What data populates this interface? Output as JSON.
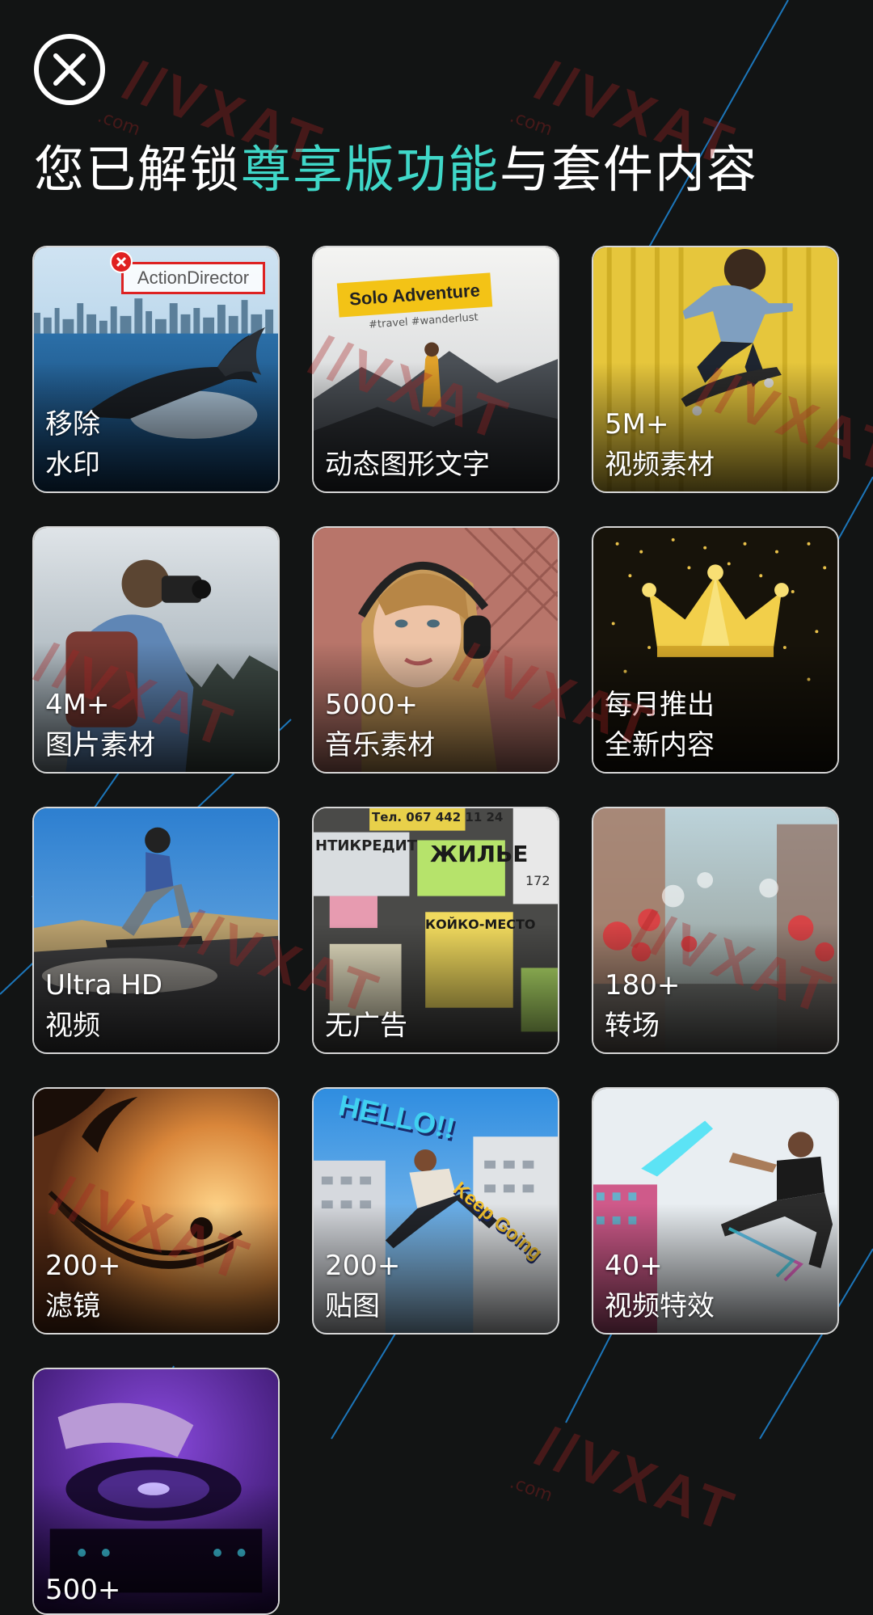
{
  "header": {
    "close_icon": "close-icon",
    "title_prefix": "您已解锁",
    "title_accent": "尊享版功能",
    "title_suffix": "与套件内容"
  },
  "colors": {
    "background": "#121414",
    "accent": "#3fd7c8",
    "card_border": "#d6d6d6",
    "line": "#1e88d8"
  },
  "features": [
    {
      "line1": "移除",
      "line2": "水印",
      "badge": "ActionDirector"
    },
    {
      "line1": "",
      "line2": "动态图形文字",
      "badge_title": "Solo Adventure",
      "badge_tags": "#travel #wanderlust"
    },
    {
      "line1": "5M+",
      "line2": "视频素材"
    },
    {
      "line1": "4M+",
      "line2": "图片素材"
    },
    {
      "line1": "5000+",
      "line2": "音乐素材"
    },
    {
      "line1": "每月推出",
      "line2": "全新内容"
    },
    {
      "line1": "Ultra HD",
      "line2": "视频"
    },
    {
      "line1": "",
      "line2": "无广告",
      "poster_phone": "Тел. 067 442 11 24",
      "poster_word": "ЖИЛЬЕ",
      "poster_left": "НТИКРЕДИТ",
      "poster_mid": "КОЙКО-МЕСТО",
      "poster_num": "172"
    },
    {
      "line1": "180+",
      "line2": "转场"
    },
    {
      "line1": "200+",
      "line2": "滤镜"
    },
    {
      "line1": "200+",
      "line2": "贴图",
      "sticker": "HELLO!!",
      "sticker2": "Keep Going"
    },
    {
      "line1": "40+",
      "line2": "视频特效"
    },
    {
      "line1": "500+",
      "line2": ""
    }
  ],
  "watermark": {
    "text": "//VXAT",
    "sub": ".com"
  }
}
